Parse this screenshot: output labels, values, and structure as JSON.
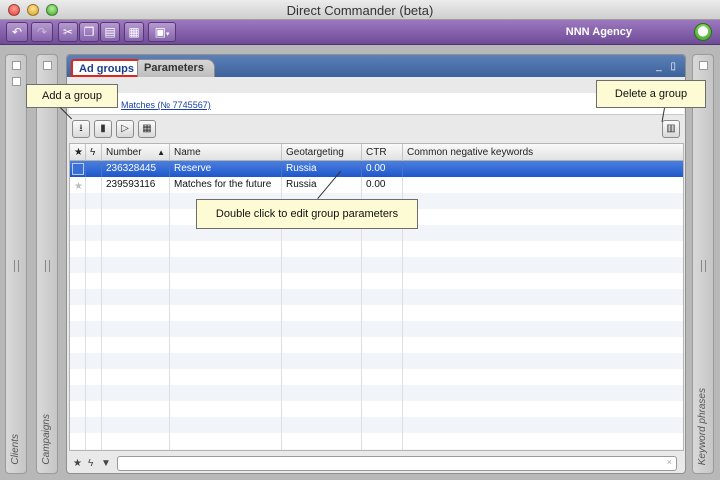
{
  "window": {
    "title": "Direct Commander (beta)"
  },
  "toolbar": {
    "agency": "NNN Agency"
  },
  "panels": {
    "clients": "Clients",
    "campaigns": "Campaigns",
    "keywords": "Keyword phrases"
  },
  "tabs": {
    "active": "Ad groups",
    "inactive": "Parameters"
  },
  "campaign": {
    "link": "Matches (№ 7745567)"
  },
  "table": {
    "columns": [
      "Number",
      "Name",
      "Geotargeting",
      "CTR",
      "Common negative keywords"
    ],
    "rows": [
      {
        "number": "236328445",
        "name": "Reserve",
        "geo": "Russia",
        "ctr": "0.00",
        "neg": ""
      },
      {
        "number": "239593116",
        "name": "Matches for the future",
        "geo": "Russia",
        "ctr": "0.00",
        "neg": ""
      }
    ]
  },
  "callouts": {
    "add_group": "Add a group",
    "delete_group": "Delete a group",
    "double_click": "Double click to edit group parameters"
  },
  "icons": {
    "sort": "▲",
    "clear": "×"
  }
}
